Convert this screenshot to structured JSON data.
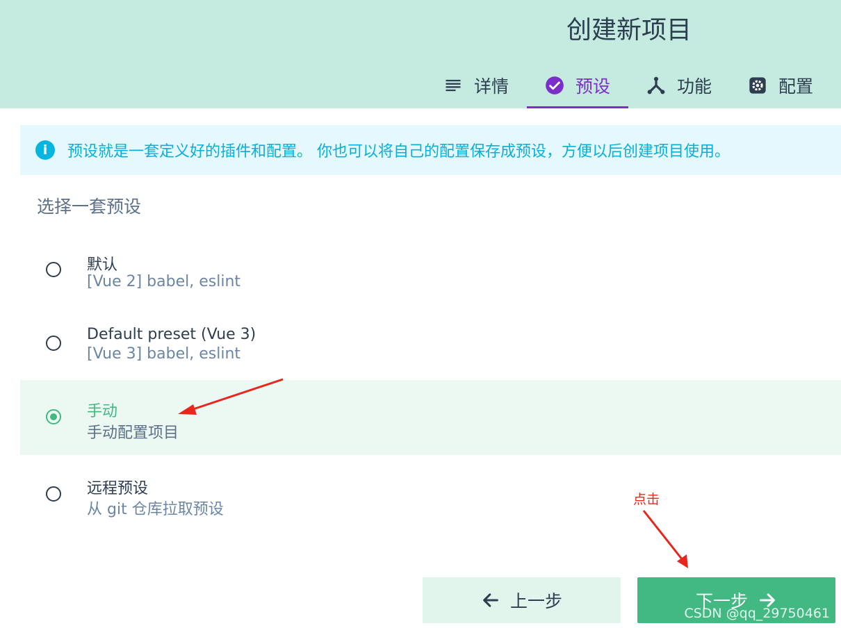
{
  "header": {
    "title": "创建新项目",
    "tabs": [
      {
        "label": "详情",
        "icon": "list-icon"
      },
      {
        "label": "预设",
        "icon": "check-circle-icon",
        "active": true
      },
      {
        "label": "功能",
        "icon": "fork-icon"
      },
      {
        "label": "配置",
        "icon": "gear-icon"
      }
    ]
  },
  "info": {
    "icon": "info-icon",
    "text": "预设就是一套定义好的插件和配置。 你也可以将自己的配置保存成预设，方便以后创建项目使用。"
  },
  "section_title": "选择一套预设",
  "presets": [
    {
      "name": "默认",
      "description": "[Vue 2] babel, eslint",
      "selected": false
    },
    {
      "name": "Default preset (Vue 3)",
      "description": "[Vue 3] babel, eslint",
      "selected": false
    },
    {
      "name": "手动",
      "description": "手动配置项目",
      "selected": true
    },
    {
      "name": "远程预设",
      "description": "从 git 仓库拉取预设",
      "selected": false
    }
  ],
  "buttons": {
    "prev_label": "上一步",
    "next_label": "下一步"
  },
  "annotation": {
    "text": "点击"
  },
  "watermark": "CSDN @qq_29750461",
  "colors": {
    "header_bg": "#c5eadf",
    "accent_purple": "#7b2ec9",
    "vue_green": "#42b983",
    "info_blue": "#06b0d8",
    "annotation_red": "#e8261b"
  }
}
